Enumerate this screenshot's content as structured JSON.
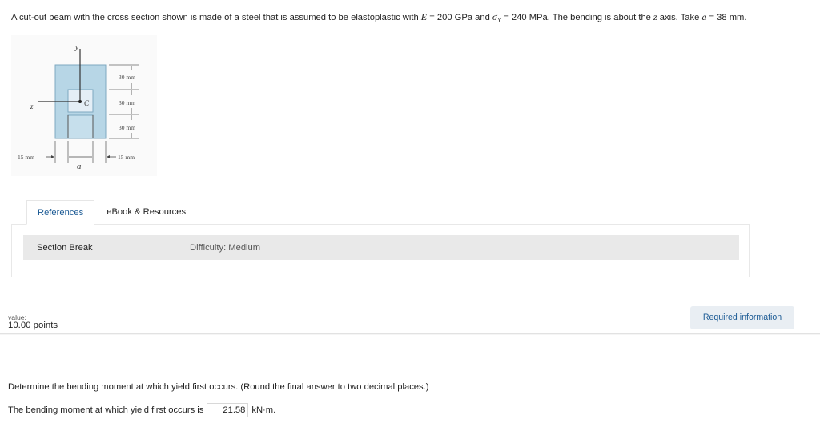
{
  "problem": {
    "part1": "A cut-out beam with the cross section shown is made of a steel that is assumed to be elastoplastic with ",
    "e_symbol": "E",
    "e_value": " = 200 GPa and ",
    "sigma_symbol": "σ",
    "sigma_sub": "Y",
    "sigma_value": " = 240 MPa. The bending is about the ",
    "z_symbol": "z",
    "part2": " axis. Take ",
    "a_symbol": "a",
    "a_value": " = 38 mm."
  },
  "figure": {
    "y_axis": "y",
    "z_axis": "z",
    "centroid": "C",
    "dim_top": "30 mm",
    "dim_mid": "30 mm",
    "dim_bottom": "30 mm",
    "dim_left": "15 mm",
    "dim_right": "15 mm",
    "dim_a": "a"
  },
  "tabs": {
    "references": "References",
    "ebook": "eBook & Resources"
  },
  "panel": {
    "section_break": "Section Break",
    "difficulty": "Difficulty: Medium"
  },
  "value_row": {
    "label": "value:",
    "points": "10.00 points",
    "required_button": "Required information"
  },
  "question": {
    "text": "Determine the bending moment at which yield first occurs. (Round the final answer to two decimal places.)",
    "answer_label": "The bending moment at which yield first occurs is",
    "answer_value": "21.58",
    "unit": "kN·m."
  }
}
